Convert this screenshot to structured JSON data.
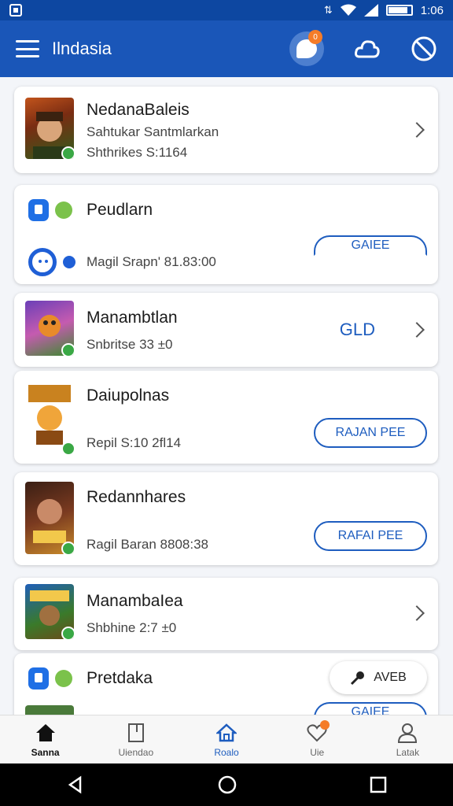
{
  "status_bar": {
    "time": "1:06",
    "battery_level": 0.8
  },
  "app_bar": {
    "title": "Ilndasia",
    "chat_badge": "0"
  },
  "cards": [
    {
      "title": "NedanaBaleis",
      "subtitle_1": "Sahtukar Santmlarkan",
      "subtitle_2": "Shthrikes  S:1164"
    },
    {
      "title": "Peudlarn",
      "subtitle": "Magil Srapn' 81.83:00",
      "button": "GAIEE"
    },
    {
      "title": "Manambtlan",
      "subtitle": "Snbritse 33 ±0",
      "value": "GLD"
    },
    {
      "title": "Daiupolnas",
      "subtitle": "Repil  S:10 2fl14",
      "button": "RAJAN PEE"
    },
    {
      "title": "Redannhares",
      "subtitle": "Ragil Baran  8808:38",
      "button": "RAFAI PEE"
    },
    {
      "title": "ManambaIea",
      "subtitle": "Shbhine 2:7 ±0"
    },
    {
      "title": "Pretdaka",
      "button": "AVEB",
      "partial_button": "GAIEE"
    }
  ],
  "bottom_nav": [
    {
      "label": "Sanna",
      "icon": "home-icon"
    },
    {
      "label": "Uiendao",
      "icon": "book-icon"
    },
    {
      "label": "Roalo",
      "icon": "house-outline-icon"
    },
    {
      "label": "Uie",
      "icon": "heart-icon"
    },
    {
      "label": "Latak",
      "icon": "person-icon"
    }
  ],
  "colors": {
    "primary": "#1a56b8",
    "accent": "#1e5dbf",
    "badge": "#f57c28",
    "check": "#3aa845"
  }
}
